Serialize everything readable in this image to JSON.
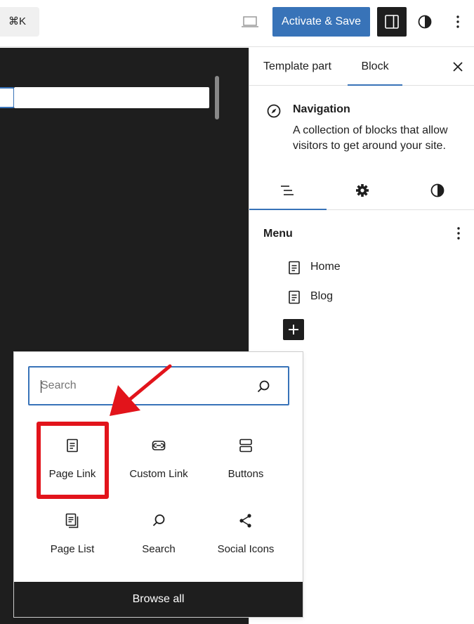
{
  "topbar": {
    "command_shortcut": "⌘K",
    "activate_label": "Activate & Save",
    "colors": {
      "primary": "#3873b8",
      "dark": "#1e1e1e"
    }
  },
  "sidebar": {
    "tabs": [
      {
        "label": "Template part"
      },
      {
        "label": "Block",
        "active": true
      }
    ],
    "block_card": {
      "icon": "compass-icon",
      "title": "Navigation",
      "description": "A collection of blocks that allow visitors to get around your site."
    },
    "subtabs": [
      "list-view-icon",
      "gear-icon",
      "contrast-icon"
    ],
    "menu": {
      "label": "Menu",
      "items": [
        {
          "label": "Home",
          "icon": "page-icon"
        },
        {
          "label": "Blog",
          "icon": "page-icon"
        }
      ]
    }
  },
  "inserter": {
    "search_placeholder": "Search",
    "blocks": [
      {
        "label": "Page Link",
        "icon": "page-icon",
        "highlighted": true
      },
      {
        "label": "Custom Link",
        "icon": "custom-link-icon"
      },
      {
        "label": "Buttons",
        "icon": "buttons-icon"
      },
      {
        "label": "Page List",
        "icon": "page-list-icon"
      },
      {
        "label": "Search",
        "icon": "search-icon"
      },
      {
        "label": "Social Icons",
        "icon": "share-icon"
      }
    ],
    "browse_all_label": "Browse all",
    "highlight_color": "#e2141b"
  }
}
